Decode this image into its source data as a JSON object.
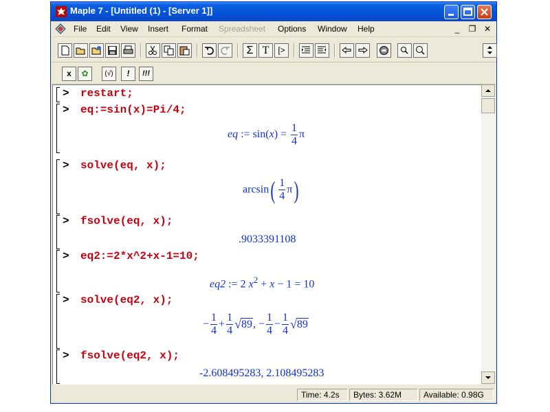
{
  "window": {
    "title": "Maple 7  - [Untitled (1) - [Server 1]]"
  },
  "menu": {
    "items": [
      "File",
      "Edit",
      "View",
      "Insert",
      "Format",
      "Spreadsheet",
      "Options",
      "Window",
      "Help"
    ],
    "disabled": [
      "Spreadsheet"
    ],
    "mdi_controls": [
      "_",
      "❐",
      "✕"
    ]
  },
  "toolbar2": {
    "buttons": [
      "x",
      "✿",
      "(√)",
      "!",
      "!!!"
    ]
  },
  "worksheet": {
    "prompt": ">",
    "cmd1": "restart;",
    "cmd2": "eq:=sin(x)=Pi/4;",
    "out2_lhs": "eq",
    "out2_mid": " := sin(",
    "out2_x": "x",
    "out2_rest": ") = ",
    "out2_num": "1",
    "out2_den": "4",
    "out2_pi": "π",
    "cmd3": "solve(eq, x);",
    "out3_fn": "arcsin",
    "out3_num": "1",
    "out3_den": "4",
    "out3_pi": "π",
    "cmd4": "fsolve(eq, x);",
    "out4": ".9033391108",
    "cmd5": "eq2:=2*x^2+x-1=10;",
    "out5_lhs": "eq2",
    "out5_a": " := 2 ",
    "out5_x": "x",
    "out5_exp": "2",
    "out5_b": " + ",
    "out5_x2": "x",
    "out5_c": " − 1 = 10",
    "cmd6": "solve(eq2, x);",
    "out6_neg": "−",
    "out6_n1": "1",
    "out6_d1": "4",
    "out6_plus": "+",
    "out6_n2": "1",
    "out6_d2": "4",
    "out6_rad1": "89",
    "out6_comma": ", −",
    "out6_n3": "1",
    "out6_d3": "4",
    "out6_minus": "−",
    "out6_n4": "1",
    "out6_d4": "4",
    "out6_rad2": "89",
    "cmd7": "fsolve(eq2, x);",
    "out7": "-2.608495283, 2.108495283"
  },
  "status": {
    "time": "Time:   4.2s",
    "bytes": "Bytes: 3.62M",
    "available": "Available: 0.98G"
  },
  "colors": {
    "command": "#c8000e",
    "output": "#1030d0",
    "titlebar": "#0453d8"
  }
}
